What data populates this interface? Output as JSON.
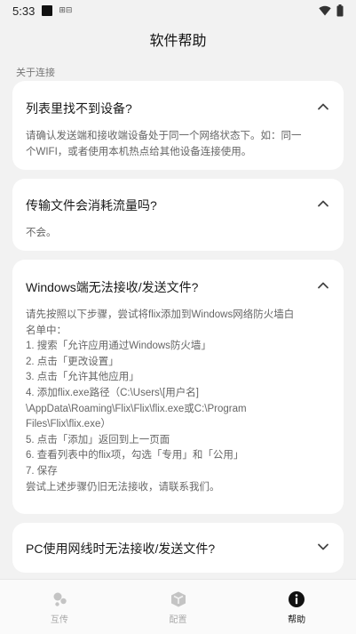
{
  "status": {
    "time": "5:33",
    "sim": "⊞⊟"
  },
  "header": {
    "title": "软件帮助"
  },
  "section": {
    "label": "关于连接"
  },
  "faq": [
    {
      "question": "列表里找不到设备?",
      "expanded": true,
      "answer_lines": [
        "请确认发送端和接收端设备处于同一个网络状态下。如：同一",
        "个WIFI，或者使用本机热点给其他设备连接使用。"
      ]
    },
    {
      "question": "传输文件会消耗流量吗?",
      "expanded": true,
      "answer_lines": [
        "不会。"
      ]
    },
    {
      "question": "Windows端无法接收/发送文件?",
      "expanded": true,
      "answer_lines": [
        "请先按照以下步骤，尝试将flix添加到Windows网络防火墙白",
        "名单中：",
        "1. 搜索「允许应用通过Windows防火墙」",
        "2. 点击「更改设置」",
        "3. 点击「允许其他应用」",
        "4. 添加flix.exe路径（C:\\Users\\[用户名]",
        "\\AppData\\Roaming\\Flix\\Flix\\flix.exe或C:\\Program",
        "Files\\Flix\\flix.exe）",
        "5. 点击「添加」返回到上一页面",
        "6. 查看列表中的flix项，勾选「专用」和「公用」",
        "7. 保存",
        "尝试上述步骤仍旧无法接收，请联系我们。"
      ]
    },
    {
      "question": "PC使用网线时无法接收/发送文件?",
      "expanded": false,
      "answer_lines": []
    }
  ],
  "nav": {
    "items": [
      {
        "label": "互传",
        "icon": "bubbles-icon",
        "active": false
      },
      {
        "label": "配置",
        "icon": "box-icon",
        "active": false
      },
      {
        "label": "帮助",
        "icon": "info-icon",
        "active": true
      }
    ]
  },
  "colors": {
    "background": "#f2f2f2",
    "card": "#ffffff",
    "active": "#111111",
    "inactive": "#aaaaaa"
  }
}
